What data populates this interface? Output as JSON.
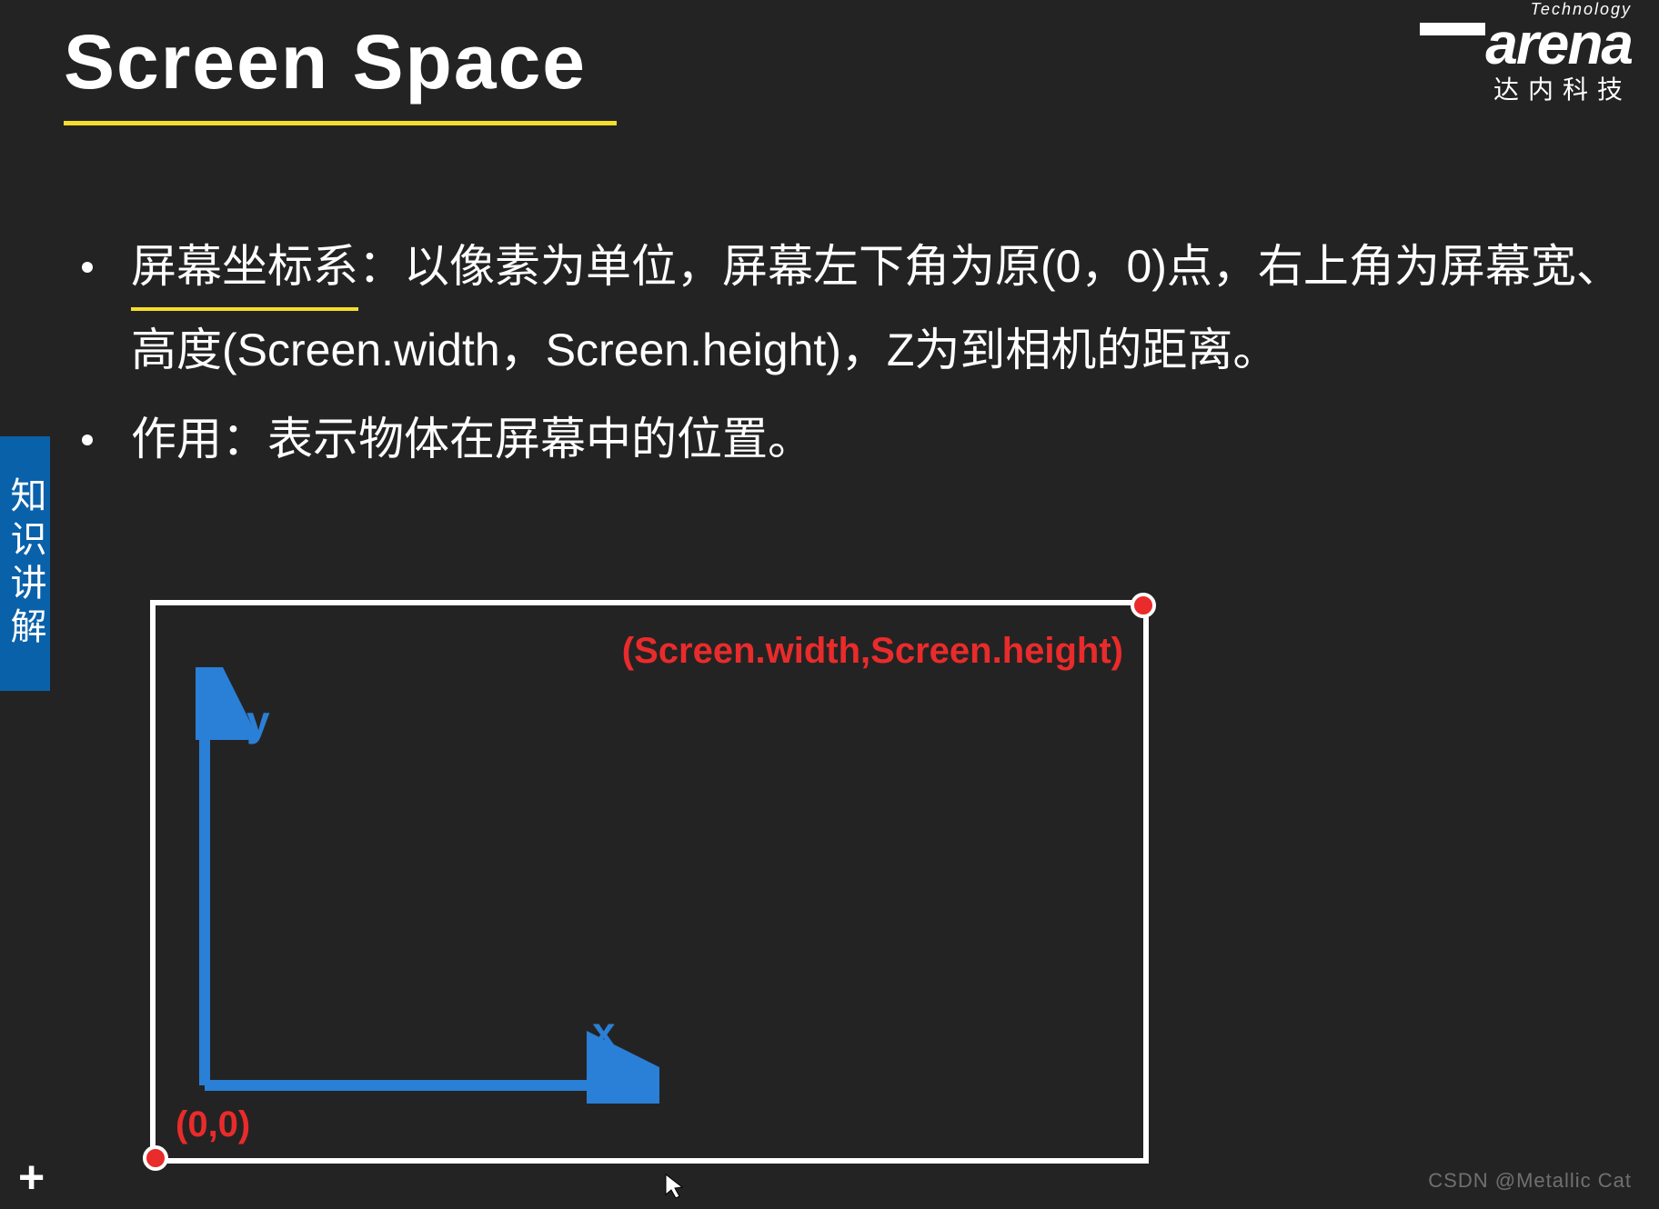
{
  "title": "Screen Space",
  "logo": {
    "tech": "Technology",
    "main": "arena",
    "cn": "达内科技"
  },
  "bullets": [
    {
      "keyword": "屏幕坐标系",
      "rest": "：以像素为单位，屏幕左下角为原(0，0)点，右上角为屏幕宽、高度(Screen.width，Screen.height)，Z为到相机的距离。"
    },
    {
      "text": "作用：表示物体在屏幕中的位置。"
    }
  ],
  "sidebar": "知识讲解",
  "diagram": {
    "top_right_label": "(Screen.width,Screen.height)",
    "origin_label": "(0,0)",
    "y_label": "y",
    "x_label": "x"
  },
  "footer_plus": "+",
  "watermark": "CSDN @Metallic Cat"
}
